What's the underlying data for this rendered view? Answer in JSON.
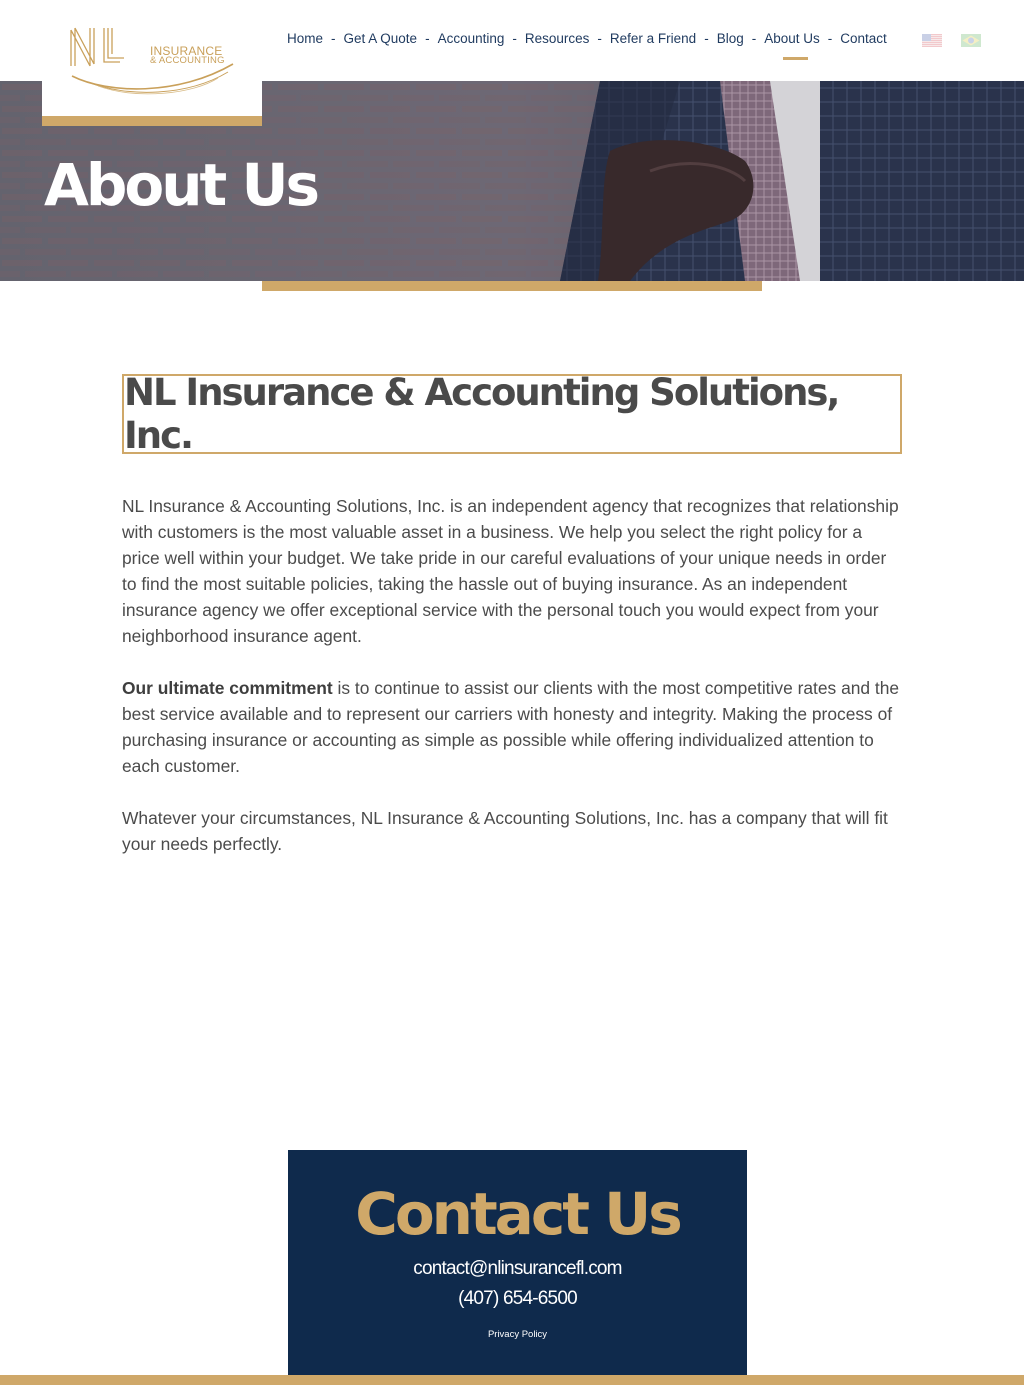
{
  "logo": {
    "line1": "INSURANCE",
    "line2": "& ACCOUNTING"
  },
  "nav": {
    "items": [
      "Home",
      "Get A Quote",
      "Accounting",
      "Resources",
      "Refer a Friend",
      "Blog",
      "About Us",
      "Contact"
    ],
    "active": "About Us",
    "flags": [
      "us-flag-icon",
      "brazil-flag-icon"
    ]
  },
  "hero": {
    "title": "About Us"
  },
  "main": {
    "heading": "NL Insurance & Accounting Solutions, Inc.",
    "p1": "NL Insurance & Accounting Solutions, Inc. is an independent agency that recognizes that relationship with customers is the most valuable asset in a business. We help you select the right policy for a price well within your budget. We take pride in our careful evaluations of your unique needs in order to find the most suitable policies, taking the hassle out of buying insurance. As an independent insurance agency we offer exceptional service with the personal touch you would expect from your neighborhood insurance agent.",
    "p2_bold": "Our ultimate commitment",
    "p2_rest": " is to continue to assist our clients with the most competitive rates and the best service available and to represent our carriers with honesty and integrity. Making the process of purchasing insurance or accounting as simple as possible while offering individualized attention to each customer.",
    "p3": "Whatever your circumstances, NL Insurance & Accounting Solutions, Inc. has a company that will fit your needs perfectly."
  },
  "contact": {
    "title": "Contact Us",
    "email": "contact@nlinsurancefl.com",
    "phone": "(407) 654-6500",
    "privacy": "Privacy Policy"
  },
  "colors": {
    "gold": "#cfa869",
    "navy": "#0f2a4c",
    "nav_text": "#1f3a5f"
  }
}
